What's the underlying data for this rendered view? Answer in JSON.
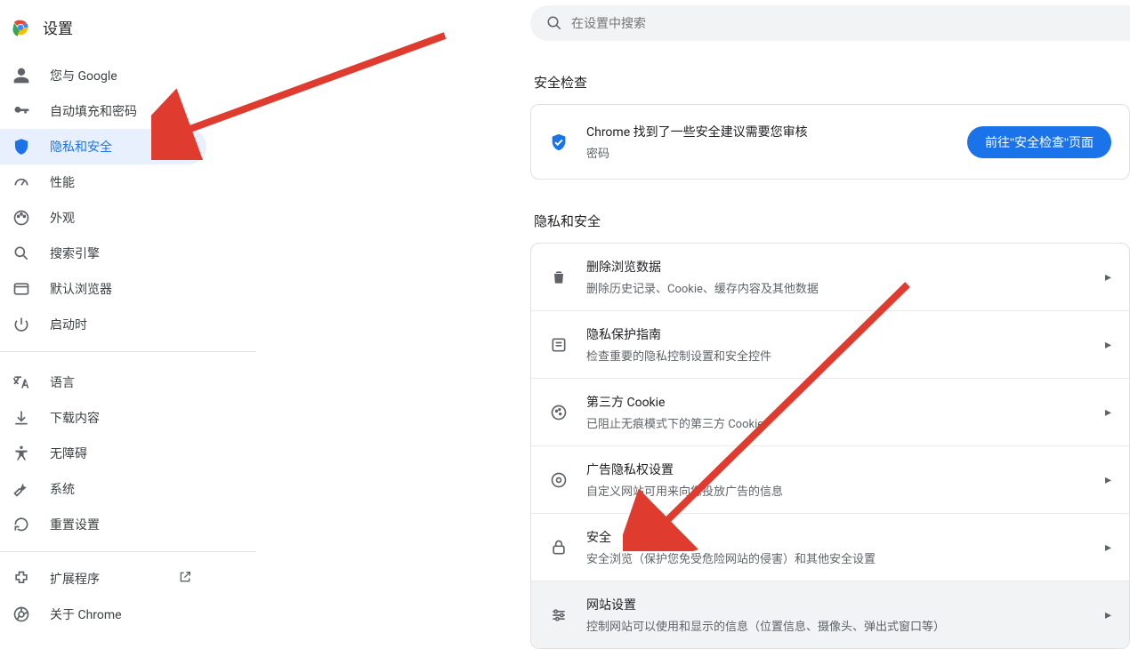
{
  "app_title": "设置",
  "search_placeholder": "在设置中搜索",
  "sidebar": {
    "items": [
      {
        "label": "您与 Google"
      },
      {
        "label": "自动填充和密码"
      },
      {
        "label": "隐私和安全"
      },
      {
        "label": "性能"
      },
      {
        "label": "外观"
      },
      {
        "label": "搜索引擎"
      },
      {
        "label": "默认浏览器"
      },
      {
        "label": "启动时"
      }
    ],
    "items2": [
      {
        "label": "语言"
      },
      {
        "label": "下载内容"
      },
      {
        "label": "无障碍"
      },
      {
        "label": "系统"
      },
      {
        "label": "重置设置"
      }
    ],
    "extensions_label": "扩展程序",
    "about_label": "关于 Chrome"
  },
  "section_safety_title": "安全检查",
  "safety_card": {
    "title": "Chrome 找到了一些安全建议需要您审核",
    "sub": "密码",
    "button": "前往\"安全检查\"页面"
  },
  "section_privacy_title": "隐私和安全",
  "privacy_rows": [
    {
      "title": "删除浏览数据",
      "sub": "删除历史记录、Cookie、缓存内容及其他数据"
    },
    {
      "title": "隐私保护指南",
      "sub": "检查重要的隐私控制设置和安全控件"
    },
    {
      "title": "第三方 Cookie",
      "sub": "已阻止无痕模式下的第三方 Cookie"
    },
    {
      "title": "广告隐私权设置",
      "sub": "自定义网站可用来向您投放广告的信息"
    },
    {
      "title": "安全",
      "sub": "安全浏览（保护您免受危险网站的侵害）和其他安全设置"
    },
    {
      "title": "网站设置",
      "sub": "控制网站可以使用和显示的信息（位置信息、摄像头、弹出式窗口等）"
    }
  ],
  "colors": {
    "accent": "#1a73e8",
    "arrow": "#e03b2f"
  }
}
